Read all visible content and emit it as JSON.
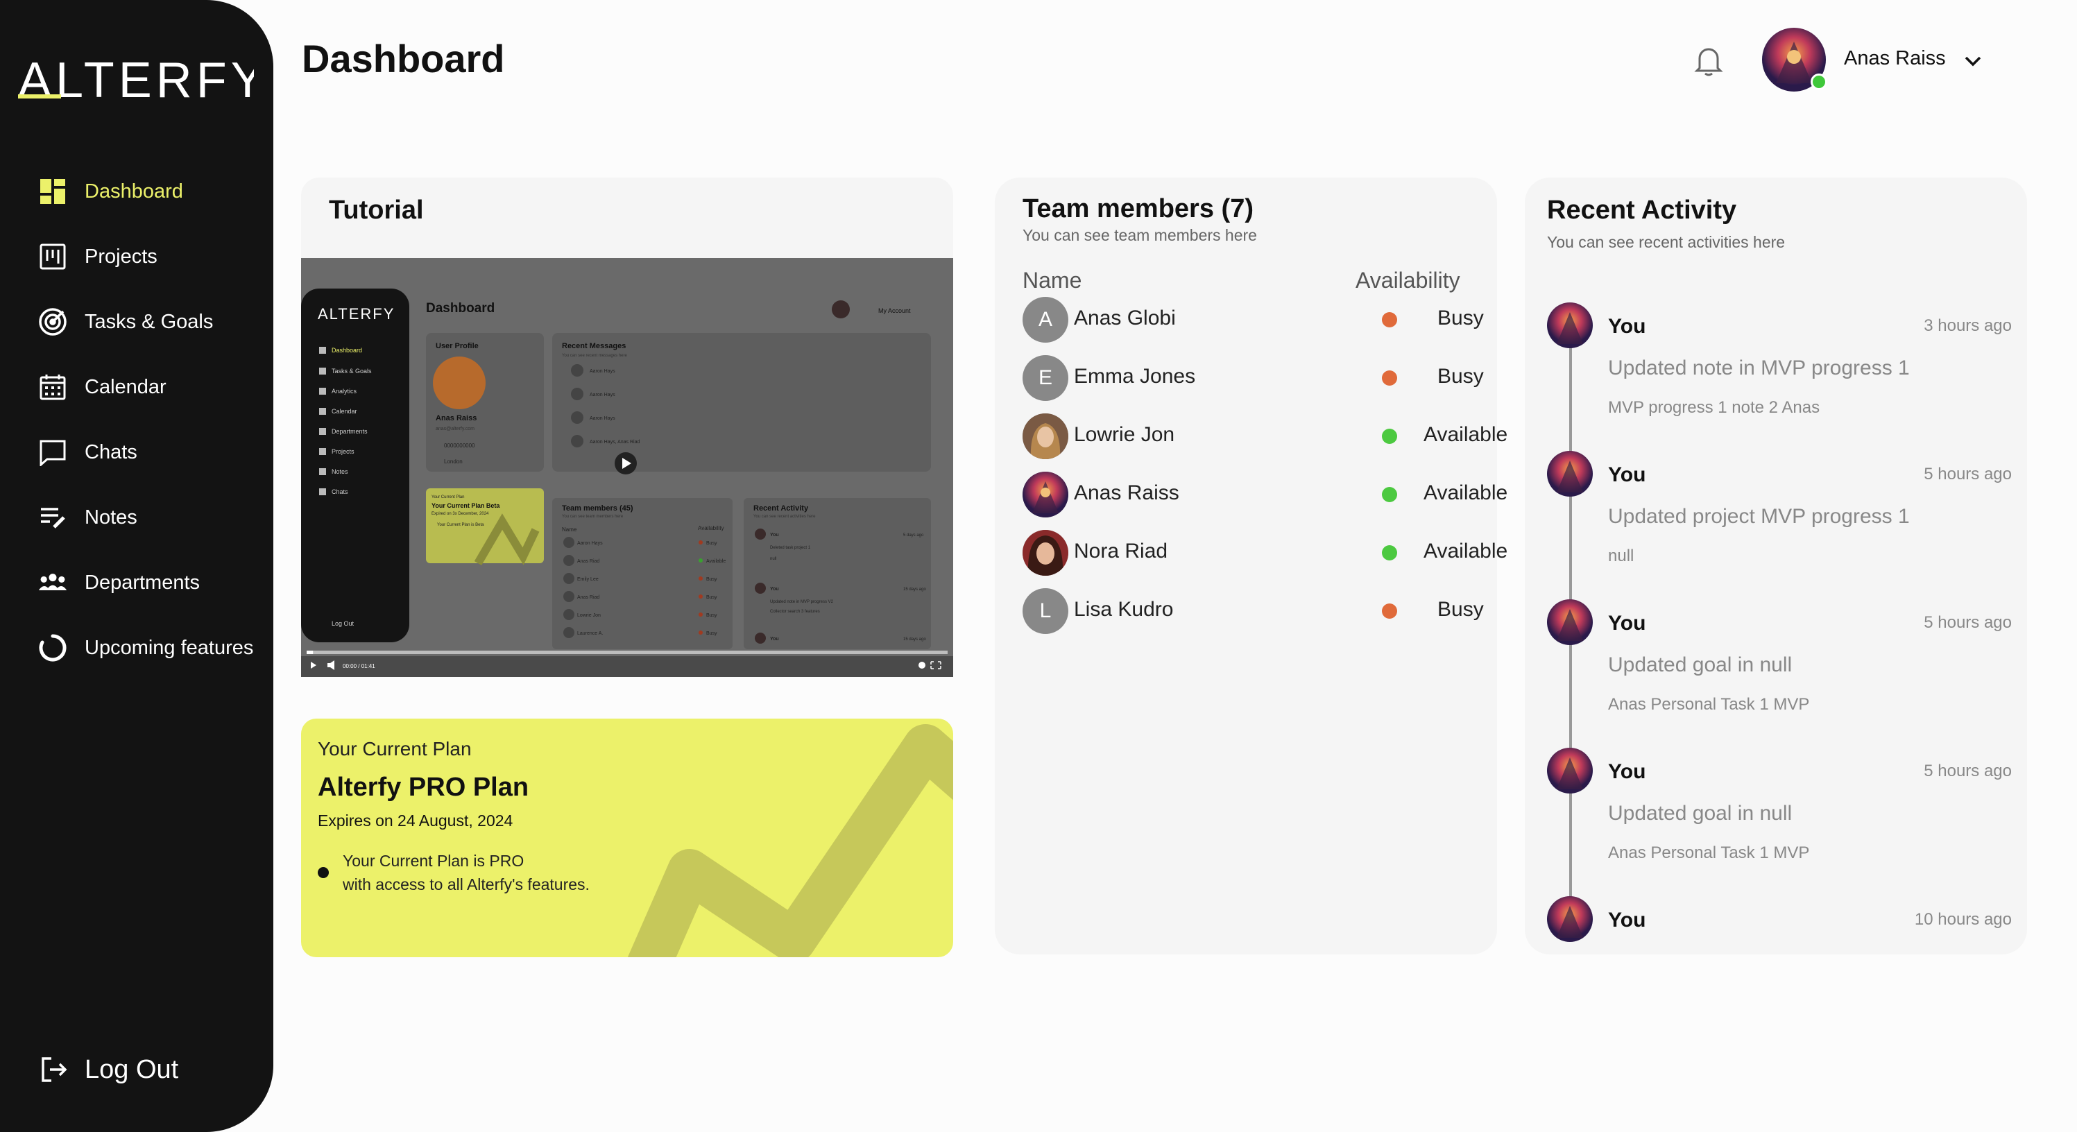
{
  "app": {
    "logo_text": "ALTERFY",
    "accent": "#ecf16a"
  },
  "sidebar": {
    "items": [
      {
        "label": "Dashboard",
        "icon": "dashboard-icon",
        "active": true
      },
      {
        "label": "Projects",
        "icon": "projects-icon"
      },
      {
        "label": "Tasks & Goals",
        "icon": "target-icon"
      },
      {
        "label": "Calendar",
        "icon": "calendar-icon"
      },
      {
        "label": "Chats",
        "icon": "chat-icon"
      },
      {
        "label": "Notes",
        "icon": "notes-icon"
      },
      {
        "label": "Departments",
        "icon": "people-icon"
      },
      {
        "label": "Upcoming features",
        "icon": "loading-icon"
      }
    ],
    "logout_label": "Log Out"
  },
  "header": {
    "title": "Dashboard",
    "user_name": "Anas Raiss",
    "status": "online"
  },
  "tutorial": {
    "title": "Tutorial",
    "video": {
      "logo": "ALTERFY",
      "title": "Dashboard",
      "account": "My Account",
      "profile_label": "User Profile",
      "profile_name": "Anas Raiss",
      "profile_email": "anas@alterfy.com",
      "profile_phone": "0000000000",
      "profile_location": "London",
      "messages_label": "Recent Messages",
      "messages_sub": "You can see recent messages here",
      "message_names": [
        "Aaron Hays",
        "Aaron Hays",
        "Aaron Hays",
        "Aaron Hays, Anas Riad"
      ],
      "plan_sub": "Your Current Plan",
      "plan_name": "Your Current Plan Beta",
      "plan_exp": "Expired on 3x December, 2024",
      "plan_note": "Your Current Plan is Beta",
      "team_label": "Team members (45)",
      "team_sub": "You can see team members here",
      "team_name_col": "Name",
      "team_avail_col": "Availability",
      "team_rows": [
        {
          "name": "Aaron Hays",
          "status": "Busy"
        },
        {
          "name": "Anas Riad",
          "status": "Available"
        },
        {
          "name": "Emily Lee",
          "status": "Busy"
        },
        {
          "name": "Anas Riad",
          "status": "Busy"
        },
        {
          "name": "Lowrie Jon",
          "status": "Busy"
        },
        {
          "name": "Laurence A.",
          "status": "Busy"
        }
      ],
      "activity_label": "Recent Activity",
      "activity_sub": "You can see recent activities here",
      "activity_rows": [
        {
          "who": "You",
          "what": "Deleted task project 1",
          "detail": "null",
          "time": "5 days ago"
        },
        {
          "who": "You",
          "what": "Updated note in MVP progress V2",
          "detail": "Collector search 3 features",
          "time": "15 days ago"
        },
        {
          "who": "You",
          "what": "",
          "detail": "",
          "time": "15 days ago"
        }
      ],
      "nav": [
        "Dashboard",
        "Tasks & Goals",
        "Analytics",
        "Calendar",
        "Departments",
        "Projects",
        "Notes",
        "Chats"
      ],
      "logout": "Log Out",
      "timestamp": "00:00 / 01:41",
      "progress": 0.01
    }
  },
  "plan": {
    "subtitle": "Your Current Plan",
    "name": "Alterfy PRO Plan",
    "expires": "Expires on 24 August, 2024",
    "note_line1": "Your Current Plan is PRO",
    "note_line2": "with access to all Alterfy's features."
  },
  "team": {
    "title": "Team members (7)",
    "subtitle": "You can see team members here",
    "col_name": "Name",
    "col_availability": "Availability",
    "members": [
      {
        "name": "Anas Globi",
        "initial": "A",
        "status": "Busy",
        "status_color": "#e06a3a",
        "photo": false
      },
      {
        "name": "Emma Jones",
        "initial": "E",
        "status": "Busy",
        "status_color": "#e06a3a",
        "photo": false
      },
      {
        "name": "Lowrie Jon",
        "initial": "",
        "status": "Available",
        "status_color": "#4cc940",
        "photo": true
      },
      {
        "name": "Anas Raiss",
        "initial": "",
        "status": "Available",
        "status_color": "#4cc940",
        "photo": true
      },
      {
        "name": "Nora Riad",
        "initial": "",
        "status": "Available",
        "status_color": "#4cc940",
        "photo": true
      },
      {
        "name": "Lisa Kudro",
        "initial": "L",
        "status": "Busy",
        "status_color": "#e06a3a",
        "photo": false
      }
    ]
  },
  "activity": {
    "title": "Recent Activity",
    "subtitle": "You can see recent activities here",
    "items": [
      {
        "who": "You",
        "time": "3 hours ago",
        "action": "Updated note in  MVP progress 1",
        "detail": "MVP progress 1 note 2 Anas"
      },
      {
        "who": "You",
        "time": "5 hours ago",
        "action": "Updated project  MVP progress 1",
        "detail": "null"
      },
      {
        "who": "You",
        "time": "5 hours ago",
        "action": "Updated goal in  null",
        "detail": "Anas Personal Task 1 MVP"
      },
      {
        "who": "You",
        "time": "5 hours ago",
        "action": "Updated goal in  null",
        "detail": "Anas Personal Task 1 MVP"
      },
      {
        "who": "You",
        "time": "10 hours ago",
        "action": "",
        "detail": ""
      }
    ]
  }
}
